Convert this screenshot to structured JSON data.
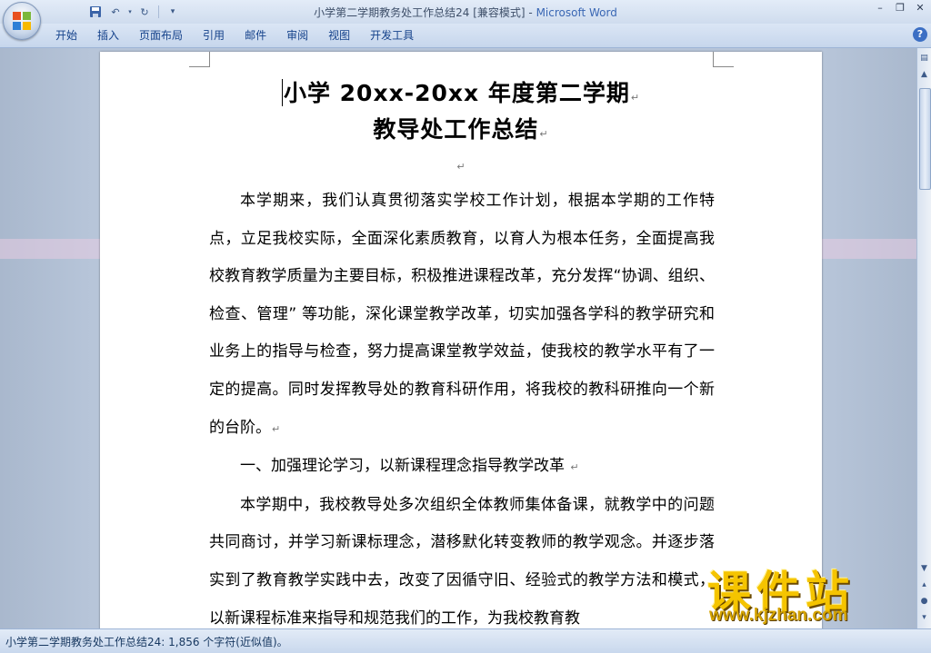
{
  "window": {
    "title": "小学第二学期教务处工作总结24 [兼容模式] - ",
    "app_name": "Microsoft Word",
    "controls": [
      "–",
      "❐",
      "✕"
    ]
  },
  "quick_access": [
    "save-icon",
    "undo-icon",
    "redo-icon",
    "customize-icon"
  ],
  "ribbon": {
    "tabs": [
      "开始",
      "插入",
      "页面布局",
      "引用",
      "邮件",
      "审阅",
      "视图",
      "开发工具"
    ],
    "help": "?"
  },
  "document": {
    "title_line1": "小学 20xx-20xx 年度第二学期",
    "title_line2": "教导处工作总结",
    "para_mark": "↵",
    "paragraphs": [
      "本学期来，我们认真贯彻落实学校工作计划，根据本学期的工作特点，立足我校实际，全面深化素质教育，以育人为根本任务，全面提高我校教育教学质量为主要目标，积极推进课程改革，充分发挥“协调、组织、检查、管理” 等功能，深化课堂教学改革，切实加强各学科的教学研究和业务上的指导与检查，努力提高课堂教学效益，使我校的教学水平有了一定的提高。同时发挥教导处的教育科研作用，将我校的教科研推向一个新的台阶。",
      "一、加强理论学习，以新课程理念指导教学改革 ",
      "本学期中，我校教导处多次组织全体教师集体备课，就教学中的问题共同商讨，并学习新课标理念，潜移默化转变教师的教学观念。并逐步落实到了教育教学实践中去，改变了因循守旧、经验式的教学方法和模式，以新课程标准来指导和规范我们的工作，为我校教育教"
    ]
  },
  "status_bar": {
    "text": "小学第二学期教务处工作总结24: 1,856 个字符(近似值)。"
  },
  "watermark": {
    "cn": "课件站",
    "url": "www.kjzhan.com"
  },
  "colors": {
    "ribbon_text": "#15428b",
    "app_name": "#3a67b4",
    "workspace": "#b7c5d9",
    "watermark": "#f5c400"
  }
}
